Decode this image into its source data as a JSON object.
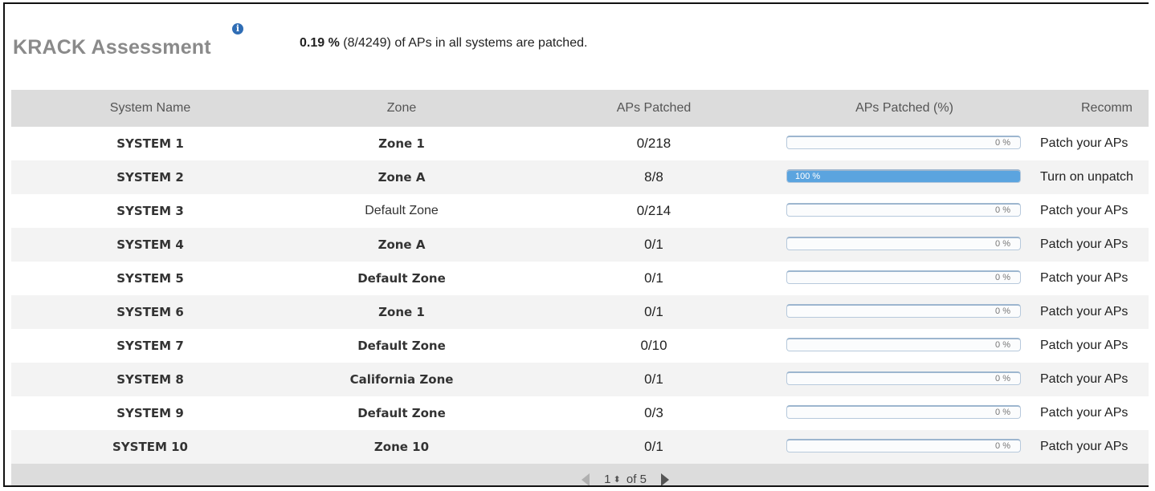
{
  "header": {
    "title": "KRACK Assessment",
    "info_icon": "info-icon",
    "summary_pct": "0.19 %",
    "summary_count": "(8/4249)",
    "summary_text": "of APs in all systems are patched."
  },
  "table": {
    "columns": [
      "System Name",
      "Zone",
      "APs Patched",
      "APs Patched (%)",
      "Recomm"
    ],
    "rows": [
      {
        "system": "SYSTEM 1",
        "zone": "Zone 1",
        "zone_bold": true,
        "aps": "0/218",
        "pct": 0,
        "pct_label": "0 %",
        "rec": "Patch your APs"
      },
      {
        "system": "SYSTEM 2",
        "zone": "Zone A",
        "zone_bold": true,
        "aps": "8/8",
        "pct": 100,
        "pct_label": "100 %",
        "rec": "Turn on unpatch"
      },
      {
        "system": "SYSTEM 3",
        "zone": "Default Zone",
        "zone_bold": false,
        "aps": "0/214",
        "pct": 0,
        "pct_label": "0 %",
        "rec": "Patch your APs"
      },
      {
        "system": "SYSTEM 4",
        "zone": "Zone A",
        "zone_bold": true,
        "aps": "0/1",
        "pct": 0,
        "pct_label": "0 %",
        "rec": "Patch your APs"
      },
      {
        "system": "SYSTEM 5",
        "zone": "Default Zone",
        "zone_bold": true,
        "aps": "0/1",
        "pct": 0,
        "pct_label": "0 %",
        "rec": "Patch your APs"
      },
      {
        "system": "SYSTEM 6",
        "zone": "Zone 1",
        "zone_bold": true,
        "aps": "0/1",
        "pct": 0,
        "pct_label": "0 %",
        "rec": "Patch your APs"
      },
      {
        "system": "SYSTEM 7",
        "zone": "Default Zone",
        "zone_bold": true,
        "aps": "0/10",
        "pct": 0,
        "pct_label": "0 %",
        "rec": "Patch your APs"
      },
      {
        "system": "SYSTEM 8",
        "zone": "California Zone",
        "zone_bold": true,
        "aps": "0/1",
        "pct": 0,
        "pct_label": "0 %",
        "rec": "Patch your APs"
      },
      {
        "system": "SYSTEM 9",
        "zone": "Default Zone",
        "zone_bold": true,
        "aps": "0/3",
        "pct": 0,
        "pct_label": "0 %",
        "rec": "Patch your APs"
      },
      {
        "system": "SYSTEM 10",
        "zone": "Zone 10",
        "zone_bold": true,
        "aps": "0/1",
        "pct": 0,
        "pct_label": "0 %",
        "rec": "Patch your APs"
      }
    ]
  },
  "pagination": {
    "page": "1",
    "of_label": "of 5",
    "prev_icon": "prev-page-icon",
    "next_icon": "next-page-icon",
    "stepper_icon": "page-stepper-icon"
  },
  "colors": {
    "progress_fill": "#5ba4df",
    "header_bg": "#dcdcdc",
    "title": "#8a8a8a"
  }
}
